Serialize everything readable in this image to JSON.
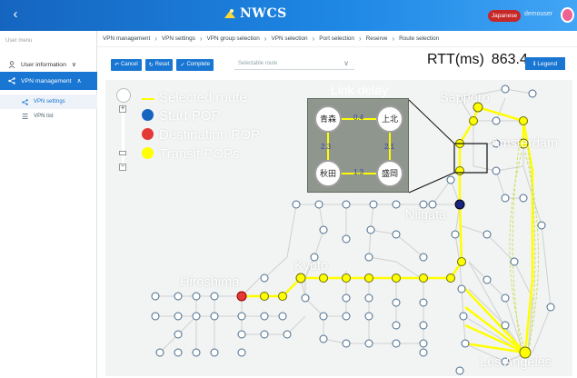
{
  "header": {
    "back_icon": "chevron-left-icon",
    "brand": "NWCS",
    "language_button": "Japanese",
    "user_name": "demouser",
    "colors": {
      "bar": "#1976d2",
      "language": "#c62828"
    }
  },
  "sidebar": {
    "caption": "User menu",
    "items": [
      {
        "label": "User information",
        "icon": "person-icon"
      },
      {
        "label": "VPN management",
        "icon": "share-icon"
      }
    ],
    "subitems": [
      {
        "label": "VPN settings",
        "icon": "share-icon"
      },
      {
        "label": "VPN list",
        "icon": "list-icon"
      }
    ]
  },
  "breadcrumb": [
    "VPN management",
    "VPN settings",
    "VPN group selection",
    "VPN selection",
    "Port selection",
    "Reserve",
    "Route selection"
  ],
  "toolbar": {
    "cancel": "Cancel",
    "reset": "Reset",
    "complete": "Complete",
    "route_select_placeholder": "Selectable route"
  },
  "rtt": {
    "label": "RTT(ms)",
    "value": "863.4"
  },
  "legend_button": "Legend",
  "map": {
    "legend": {
      "selected_route": "Selected route",
      "start_pop": "Start POP",
      "destination_pop": "Destination POP",
      "transit_pops": "Transit POPs",
      "colors": {
        "route": "#ffff00",
        "start": "#1565c0",
        "destination": "#e53935",
        "transit": "#ffff00"
      }
    },
    "cities": {
      "sapporo": "Sapporo",
      "amsterdam": "Amsterdam",
      "niigata": "Niigata",
      "kyoto": "Kyoto",
      "hiroshima": "Hiroshima",
      "los_angeles": "Los Angeles"
    },
    "inset": {
      "title": "Link delay",
      "nodes": [
        "青森",
        "上北",
        "秋田",
        "盛岡"
      ],
      "delays": [
        "0.4",
        "2.3",
        "2.1",
        "1.3"
      ]
    }
  }
}
